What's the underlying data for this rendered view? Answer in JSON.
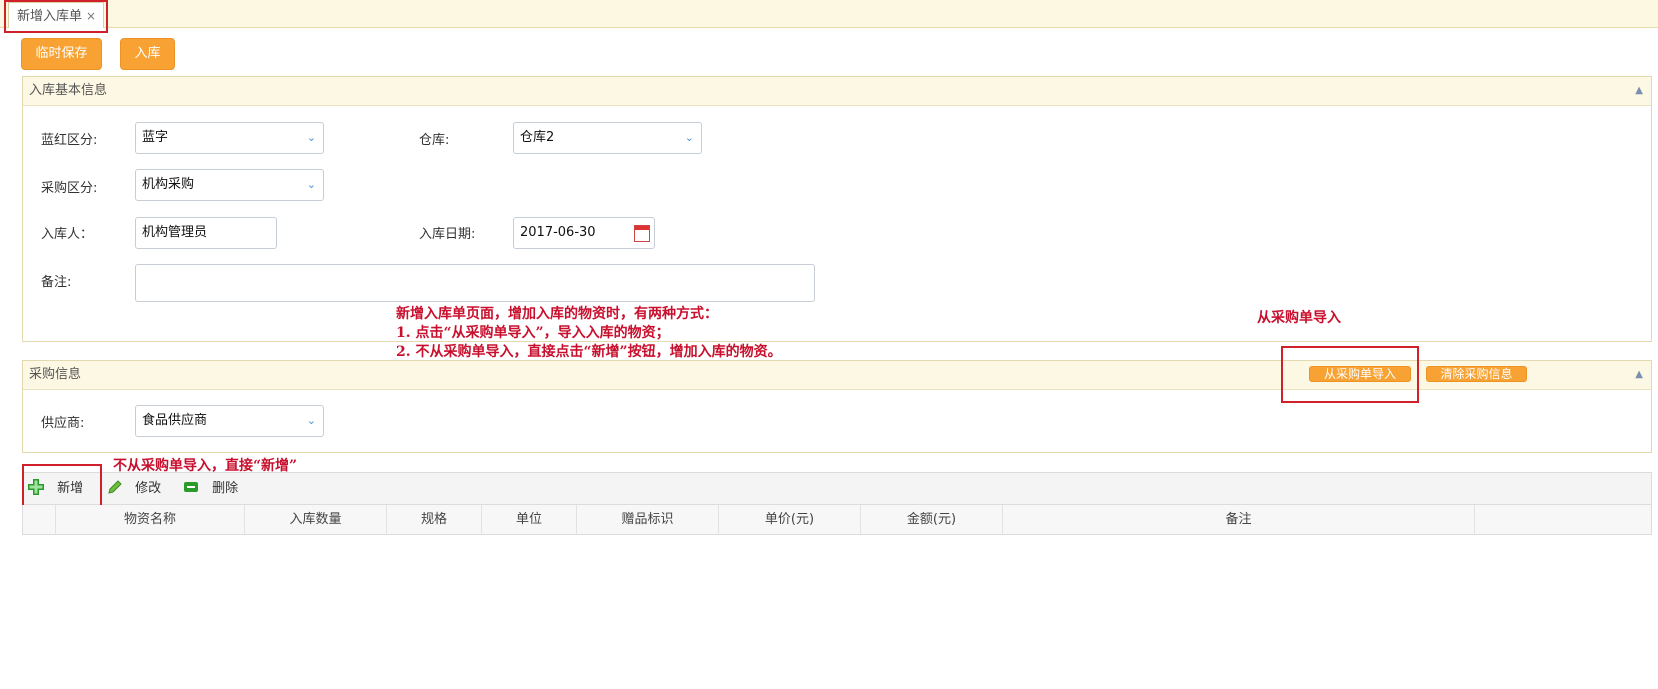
{
  "tab": {
    "title": "新增入库单",
    "close": "×"
  },
  "buttons": {
    "temp_save": "临时保存",
    "stock_in": "入库"
  },
  "basic_panel": {
    "title": "入库基本信息",
    "collapse": "▲",
    "fields": {
      "blue_red": {
        "label": "蓝红区分:",
        "value": "蓝字"
      },
      "warehouse": {
        "label": "仓库:",
        "value": "仓库2"
      },
      "purchase_type": {
        "label": "采购区分:",
        "value": "机构采购"
      },
      "receiver": {
        "label": "入库人：",
        "value": "机构管理员"
      },
      "date": {
        "label": "入库日期:",
        "value": "2017-06-30"
      },
      "remark": {
        "label": "备注:",
        "value": ""
      }
    }
  },
  "annotations": {
    "intro": [
      "新增入库单页面，增加入库的物资时，有两种方式：",
      "1. 点击“从采购单导入”，导入入库的物资；",
      "2. 不从采购单导入，直接点击“新增”按钮，增加入库的物资。"
    ],
    "import_note": "从采购单导入",
    "add_note": "不从采购单导入，直接“新增”"
  },
  "purchase_panel": {
    "title": "采购信息",
    "collapse": "▲",
    "import_button": "从采购单导入",
    "clear_button": "清除采购信息",
    "supplier": {
      "label": "供应商:",
      "value": "食品供应商"
    }
  },
  "toolbar": {
    "add": "新增",
    "edit": "修改",
    "delete": "删除"
  },
  "grid": {
    "columns": [
      "物资名称",
      "入库数量",
      "规格",
      "单位",
      "赠品标识",
      "单价(元)",
      "金额(元)",
      "备注"
    ]
  },
  "colors": {
    "accent_orange": "#f7a233",
    "annotation_red": "#c8102e",
    "panel_header": "#fdf8e3"
  }
}
